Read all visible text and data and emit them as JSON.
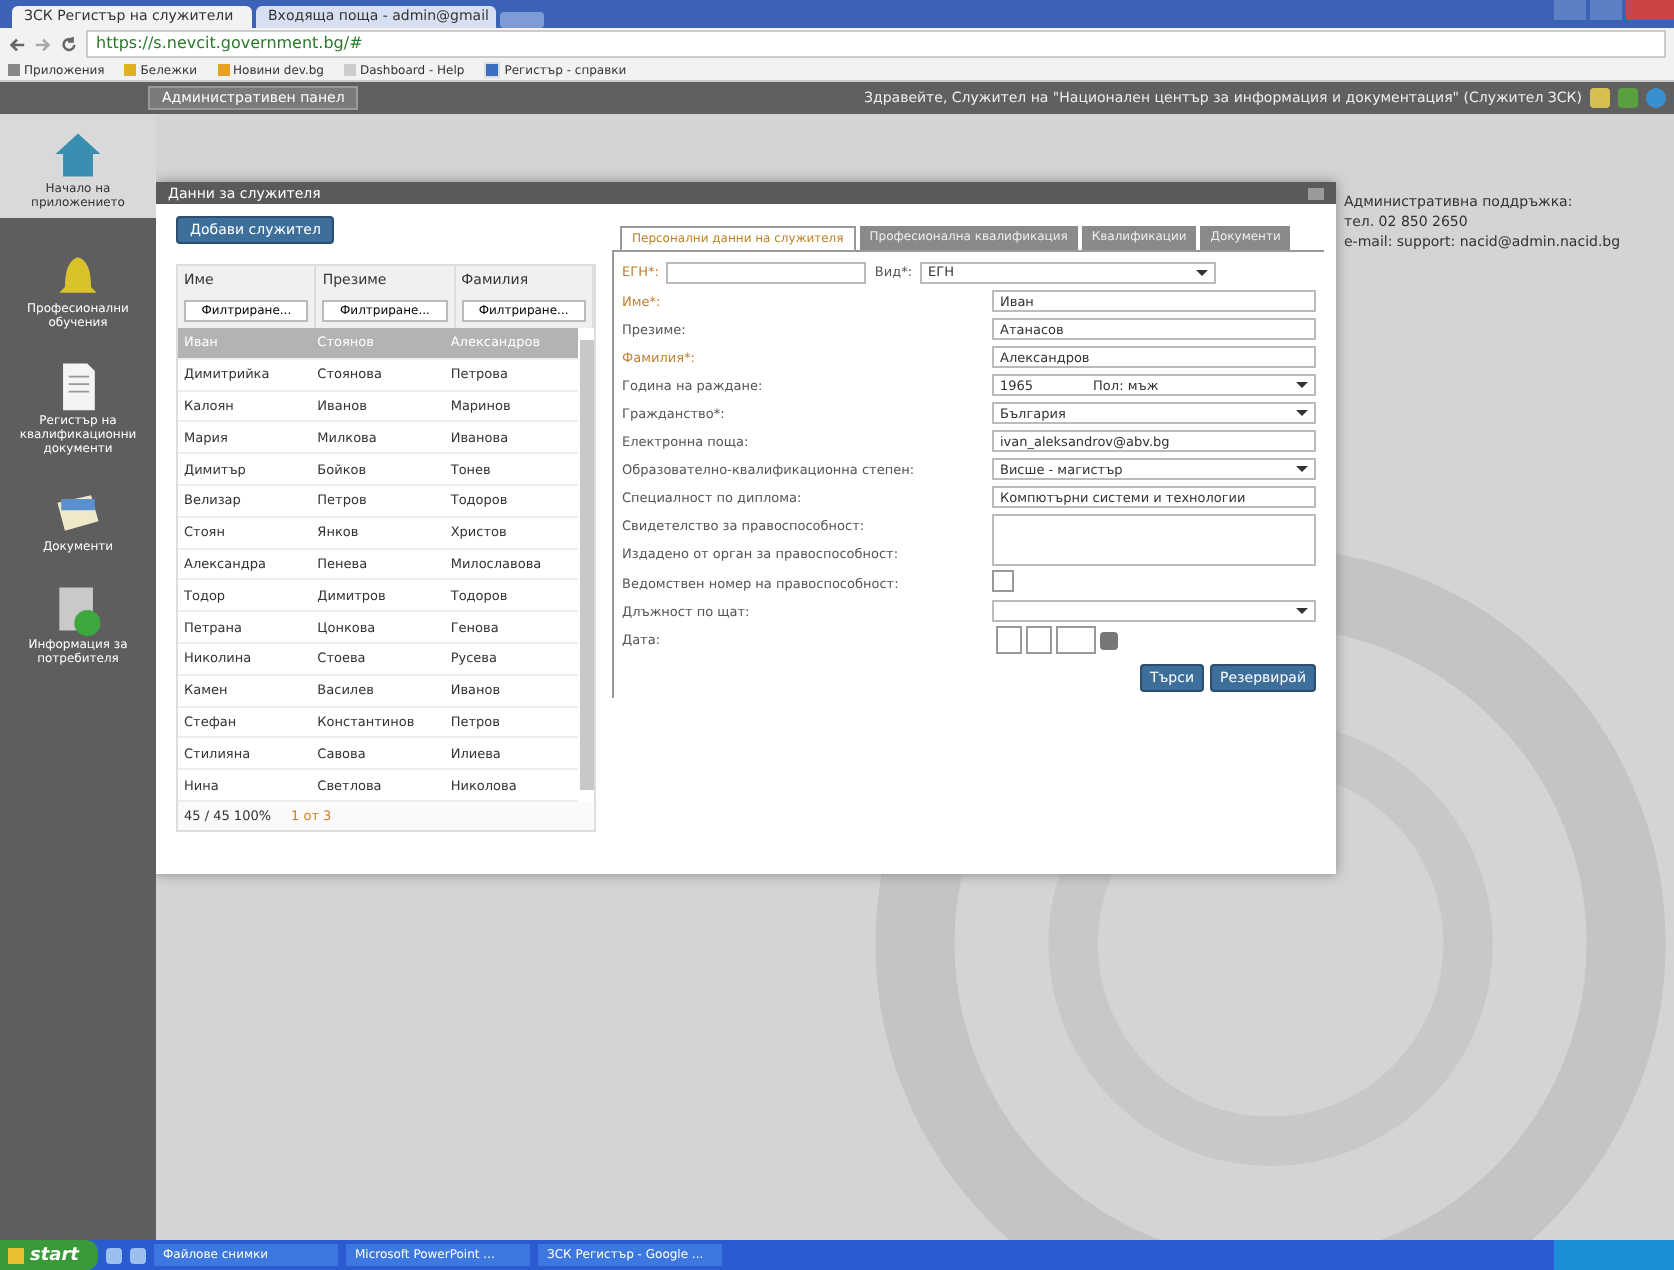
{
  "browser": {
    "tabs": [
      {
        "title": "ЗСК Регистър на служители",
        "selected": true
      },
      {
        "title": "Входяща поща - admin@gmail",
        "selected": false
      }
    ],
    "url": "https://s.nevcit.government.bg/#",
    "bookmarks": [
      {
        "label": "Приложения",
        "kind": "apps"
      },
      {
        "label": "Бележки",
        "kind": "star"
      },
      {
        "label": "Новини dev.bg",
        "kind": "orange"
      },
      {
        "label": "Dashboard - Help",
        "kind": "page"
      },
      {
        "label": "Регистър - справки",
        "kind": "grid"
      }
    ]
  },
  "header": {
    "admin_button": "Административен панел",
    "greeting": "Здравейте, Служител на \"Национален център за информация и документация\" (Служител ЗСК)"
  },
  "sidebar": {
    "top_label": "Начало на приложението",
    "items": [
      {
        "label": "Професионални обучения",
        "kind": "bell"
      },
      {
        "label": "Регистър на квалификационни документи",
        "kind": "document"
      },
      {
        "label": "Документи",
        "kind": "cards"
      },
      {
        "label": "Информация за потребителя",
        "kind": "help"
      }
    ]
  },
  "contact": [
    "Административна поддръжка:",
    "тел. 02 850 2650",
    "e-mail: support: nacid@admin.nacid.bg"
  ],
  "modal": {
    "title": "Данни за служителя",
    "add_button": "Добави служител",
    "columns": [
      {
        "label": "Име",
        "filter": "Филтриране..."
      },
      {
        "label": "Презиме",
        "filter": "Филтриране..."
      },
      {
        "label": "Фамилия",
        "filter": "Филтриране..."
      }
    ],
    "rows": [
      {
        "cells": [
          "Иван",
          "Стоянов",
          "Александров"
        ],
        "selected": true
      },
      {
        "cells": [
          "Димитрийка",
          "Стоянова",
          "Петрова"
        ],
        "selected": false
      },
      {
        "cells": [
          "Калоян",
          "Иванов",
          "Маринов"
        ],
        "selected": false
      },
      {
        "cells": [
          "Мария",
          "Милкова",
          "Иванова"
        ],
        "selected": false
      },
      {
        "cells": [
          "Димитър",
          "Бойков",
          "Тонев"
        ],
        "selected": false
      },
      {
        "cells": [
          "Велизар",
          "Петров",
          "Тодоров"
        ],
        "selected": false
      },
      {
        "cells": [
          "Стоян",
          "Янков",
          "Христов"
        ],
        "selected": false
      },
      {
        "cells": [
          "Александра",
          "Пенева",
          "Милославова"
        ],
        "selected": false
      },
      {
        "cells": [
          "Тодор",
          "Димитров",
          "Тодоров"
        ],
        "selected": false
      },
      {
        "cells": [
          "Петрана",
          "Цонкова",
          "Генова"
        ],
        "selected": false
      },
      {
        "cells": [
          "Николина",
          "Стоева",
          "Русева"
        ],
        "selected": false
      },
      {
        "cells": [
          "Камен",
          "Василев",
          "Иванов"
        ],
        "selected": false
      },
      {
        "cells": [
          "Стефан",
          "Константинов",
          "Петров"
        ],
        "selected": false
      },
      {
        "cells": [
          "Стилияна",
          "Савова",
          "Илиева"
        ],
        "selected": false
      },
      {
        "cells": [
          "Нина",
          "Светлова",
          "Николова"
        ],
        "selected": false
      }
    ],
    "footer_count": "45 / 45  100%",
    "pager": "1 от 3",
    "form_tabs": [
      {
        "label": "Персонални данни на служителя",
        "selected": true
      },
      {
        "label": "Професионална квалификация",
        "selected": false
      },
      {
        "label": "Квалификации",
        "selected": false
      },
      {
        "label": "Документи",
        "selected": false
      }
    ],
    "id_label": "ЕГН*:",
    "id_type_label": "Вид*:",
    "id_type_value": "ЕГН",
    "fields": [
      {
        "label": "Име*:",
        "kind": "text",
        "value": "Иван",
        "required": true
      },
      {
        "label": "Презиме:",
        "kind": "text",
        "value": "Атанасов",
        "required": false
      },
      {
        "label": "Фамилия*:",
        "kind": "text",
        "value": "Александров",
        "required": true
      },
      {
        "label": "Година на раждане:",
        "kind": "year",
        "value": "1965",
        "extra": "Пол: мъж",
        "required": false
      },
      {
        "label": "Гражданство*:",
        "kind": "select",
        "value": "България",
        "required": false
      },
      {
        "label": "Електронна поща:",
        "kind": "text",
        "value": "ivan_aleksandrov@abv.bg",
        "required": false
      },
      {
        "label": "Образователно-квалификационна степен:",
        "kind": "select",
        "value": "Висше - магистър",
        "required": false
      },
      {
        "label": "Специалност по диплома:",
        "kind": "text",
        "value": "Компютърни системи и технологии",
        "required": false
      },
      {
        "label": "Свидетелство за правоспособност:",
        "kind": "textarea",
        "required": false,
        "second_label": "Издадено от орган за правоспособност:"
      },
      {
        "label": "Ведомствен номер на правоспособност:",
        "kind": "checkbox",
        "checked": false,
        "required": false
      },
      {
        "label": "Длъжност по щат:",
        "kind": "select",
        "required": false
      },
      {
        "label": "Дата:",
        "kind": "date",
        "required": false
      }
    ],
    "buttons": [
      {
        "label": "Търси",
        "kind": "primary"
      },
      {
        "label": "Резервирай",
        "kind": "primary"
      }
    ]
  },
  "taskbar": {
    "start": "start",
    "items": [
      "Файлове снимки",
      "Microsoft PowerPoint ...",
      "ЗСК Регистър - Google ..."
    ]
  }
}
